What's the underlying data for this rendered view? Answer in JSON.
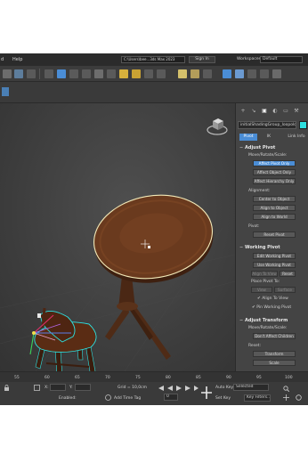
{
  "menu": {
    "items": [
      "d",
      "Help"
    ]
  },
  "titlebar": {
    "path": "C:\\Users\\bee...3ds Max 2023",
    "signin": "Sign In",
    "workspaces_label": "Workspaces:",
    "workspace_value": "Default"
  },
  "command_panel": {
    "tab_icons": [
      "+",
      "↘",
      "▣",
      "◐",
      "▭",
      "⚒"
    ],
    "object_name": "initialShadingGroup_loopolo_mesh",
    "subtabs": [
      "Pivot",
      "IK",
      "Link Info"
    ],
    "adjust_pivot": {
      "header": "Adjust Pivot",
      "move_rotate_label": "Move/Rotate/Scale:",
      "btn_affect_pivot": "Affect Pivot Only",
      "btn_affect_object": "Affect Object Only",
      "btn_affect_hierarchy": "Affect Hierarchy Only",
      "alignment_label": "Alignment:",
      "btn_center": "Center to Object",
      "btn_align_object": "Align to Object",
      "btn_align_world": "Align to World",
      "pivot_label": "Pivot:",
      "btn_reset_pivot": "Reset Pivot"
    },
    "working_pivot": {
      "header": "Working Pivot",
      "btn_edit": "Edit Working Pivot",
      "btn_use": "Use Working Pivot",
      "btn_align_view": "Align To View",
      "btn_reset": "Reset",
      "place_label": "Place Pivot To:",
      "btn_view": "View",
      "btn_surface": "Surface",
      "check_align_view": "Align To View",
      "btn_pin": "Pin Working Pivot"
    },
    "adjust_transform": {
      "header": "Adjust Transform",
      "move_rotate_label": "Move/Rotate/Scale:",
      "btn_dont_affect": "Don't Affect Children",
      "reset_label": "Reset:",
      "btn_transform": "Transform",
      "btn_scale": "Scale"
    }
  },
  "timeline": {
    "ticks": [
      "55",
      "60",
      "65",
      "70",
      "75",
      "80",
      "85",
      "90",
      "95",
      "100"
    ]
  },
  "status": {
    "grid": "Grid = 10,0cm",
    "x_label": "X:",
    "y_label": "Y:",
    "enabled_label": "Enabled:",
    "add_time_tag": "Add Time Tag",
    "auto_key": "Auto Key",
    "auto_key_value": "Selected",
    "set_key": "Set Key",
    "key_filters": "Key Filters...",
    "frame_value": "0"
  },
  "colors": {
    "accent": "#4a8dd6",
    "selection": "#2de0e0",
    "wood": "#6a3a1e"
  }
}
